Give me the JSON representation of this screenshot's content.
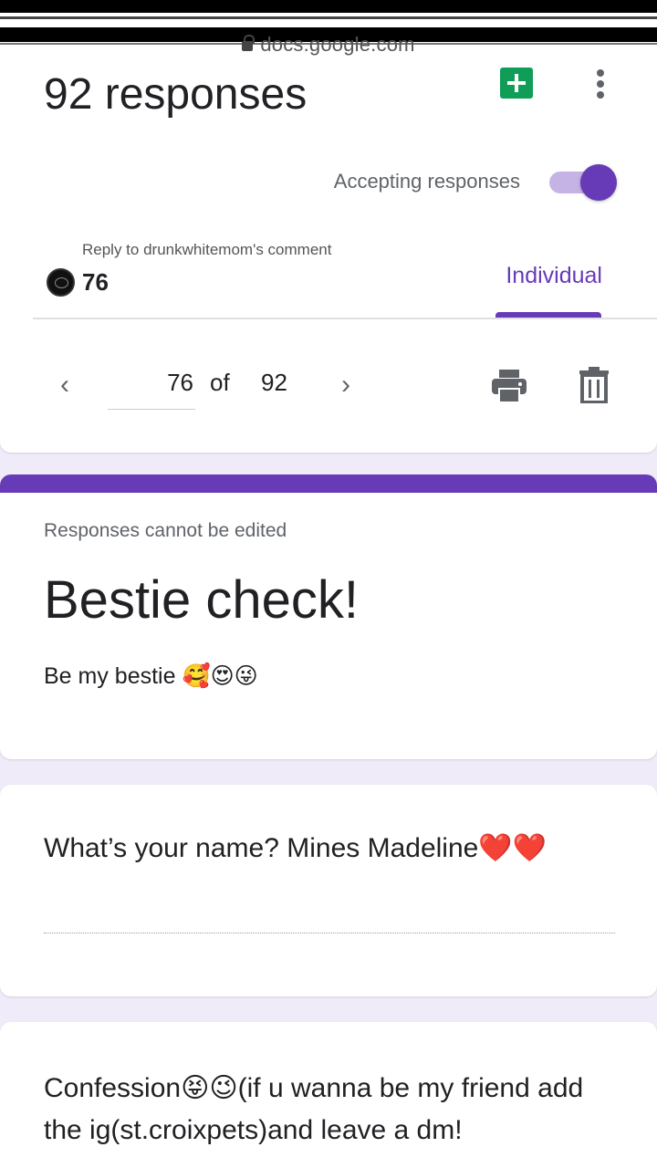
{
  "browser": {
    "url": "docs.google.com"
  },
  "header": {
    "title": "92 responses",
    "accepting_label": "Accepting responses",
    "accepting_on": true,
    "accent_color": "#673ab7",
    "sheets_color": "#0f9d58"
  },
  "comment_overlay": {
    "reply_text": "Reply to drunkwhitemom's comment",
    "count": "76"
  },
  "tabs": {
    "active": "Individual"
  },
  "pager": {
    "current": "76",
    "of_label": "of",
    "total": "92"
  },
  "form": {
    "notice": "Responses cannot be edited",
    "title": "Bestie check!",
    "description": "Be my bestie 🥰😍😜"
  },
  "questions": [
    {
      "text": "What’s your name? Mines Madeline❤️❤️"
    },
    {
      "text": "Confession😝😉(if u wanna be my friend add the ig(st.croixpets)and leave a dm!"
    }
  ],
  "icons": {
    "lock": "lock-icon",
    "sheets": "sheets-icon",
    "more": "more-vert-icon",
    "prev": "chevron-left-icon",
    "next": "chevron-right-icon",
    "print": "print-icon",
    "delete": "trash-icon"
  }
}
